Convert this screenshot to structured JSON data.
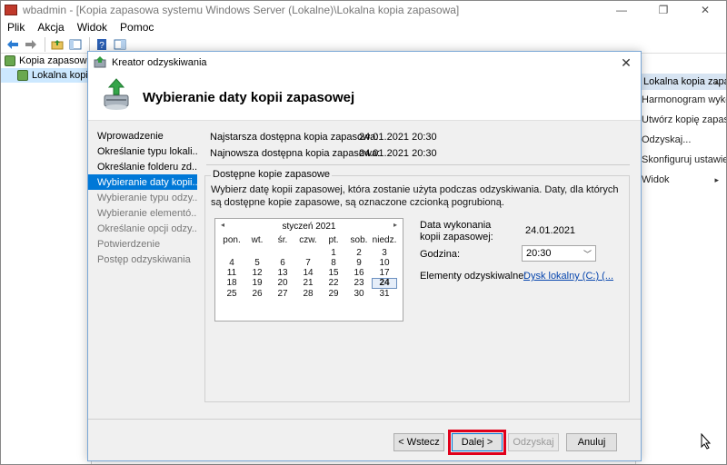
{
  "mmc": {
    "title": "wbadmin - [Kopia zapasowa systemu Windows Server (Lokalne)\\Lokalna kopia zapasowa]",
    "menu": [
      "Plik",
      "Akcja",
      "Widok",
      "Pomoc"
    ],
    "window_controls": [
      "—",
      "❐",
      "✕"
    ]
  },
  "tree": {
    "items": [
      "Kopia zapasowa sy",
      "Lokalna kopia"
    ]
  },
  "actions": {
    "header": "Lokalna kopia zapasowa",
    "items": [
      "Harmonogram wykon...",
      "Utwórz kopię zapasową raz...",
      "Odzyskaj...",
      "Skonfiguruj ustawienia ...",
      "Widok"
    ]
  },
  "wizard": {
    "title": "Kreator odzyskiwania",
    "header_title": "Wybieranie daty kopii zapasowej",
    "steps": [
      "Wprowadzenie",
      "Określanie typu lokali...",
      "Określanie folderu zd...",
      "Wybieranie daty kopii...",
      "Wybieranie typu odzy...",
      "Wybieranie elementó...",
      "Określanie opcji odzy...",
      "Potwierdzenie",
      "Postęp odzyskiwania"
    ],
    "oldest_label": "Najstarsza dostępna kopia zapasowa:",
    "oldest_value": "24.01.2021 20:30",
    "newest_label": "Najnowsza dostępna kopia zapasowa:",
    "newest_value": "24.01.2021 20:30",
    "group_title": "Dostępne kopie zapasowe",
    "group_desc": "Wybierz datę kopii zapasowej, która zostanie użyta podczas odzyskiwania. Daty, dla których są dostępne kopie zapasowe, są oznaczone czcionką pogrubioną.",
    "calendar": {
      "month": "styczeń 2021",
      "prev": "◂",
      "next": "▸",
      "dow": [
        "pon.",
        "wt.",
        "śr.",
        "czw.",
        "pt.",
        "sob.",
        "niedz."
      ],
      "selected_day": "24"
    },
    "exec_date_label": "Data wykonania kopii zapasowej:",
    "exec_date_value": "24.01.2021",
    "time_label": "Godzina:",
    "time_value": "20:30",
    "items_label": "Elementy odzyskiwalne:",
    "items_value": "Dysk lokalny (C:) (...",
    "buttons": {
      "back": "< Wstecz",
      "next": "Dalej >",
      "recover": "Odzyskaj",
      "cancel": "Anuluj"
    }
  },
  "colors": {
    "accent": "#0078d7",
    "highlight": "#e0001b"
  }
}
